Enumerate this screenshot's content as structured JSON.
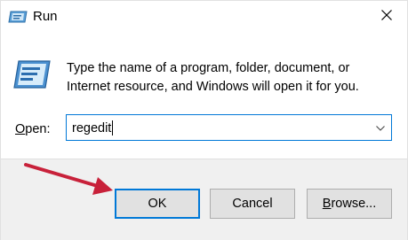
{
  "window": {
    "title": "Run"
  },
  "dialog": {
    "description": "Type the name of a program, folder, document, or Internet resource, and Windows will open it for you.",
    "open_label_accel": "O",
    "open_label_rest": "pen:",
    "input_value": "regedit"
  },
  "buttons": {
    "ok": "OK",
    "cancel": "Cancel",
    "browse_accel": "B",
    "browse_rest": "rowse..."
  },
  "icons": {
    "title": "run-icon",
    "main": "run-icon",
    "close": "close-icon",
    "dropdown": "chevron-down-icon",
    "annotation": "red-arrow"
  },
  "colors": {
    "accent": "#0078d7",
    "annotation_arrow": "#c8213a",
    "footer_bg": "#f0f0f0"
  }
}
